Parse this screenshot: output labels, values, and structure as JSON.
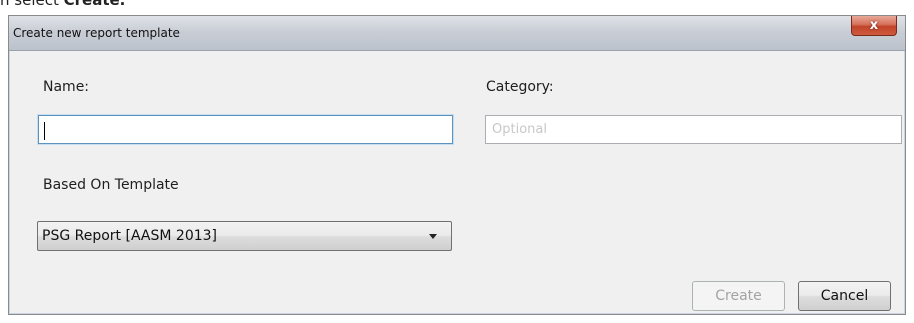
{
  "background_doc": {
    "prefix": "n select ",
    "bold_word": "Create."
  },
  "dialog": {
    "title": "Create new report template",
    "close_glyph": "x",
    "name": {
      "label": "Name:",
      "value": ""
    },
    "category": {
      "label": "Category:",
      "placeholder": "Optional",
      "value": ""
    },
    "based_on": {
      "label": "Based On Template",
      "selected": "PSG Report [AASM 2013]"
    },
    "buttons": {
      "create": "Create",
      "cancel": "Cancel"
    }
  },
  "colors": {
    "dialog_background": "#f0f0f0",
    "close_button": "#c1442a",
    "focus_border": "#5c93bf",
    "disabled_text": "#a3a3a3",
    "placeholder_text": "#c8c8c8"
  },
  "icons": {
    "close": "close-icon",
    "dropdown": "chevron-down-icon"
  }
}
